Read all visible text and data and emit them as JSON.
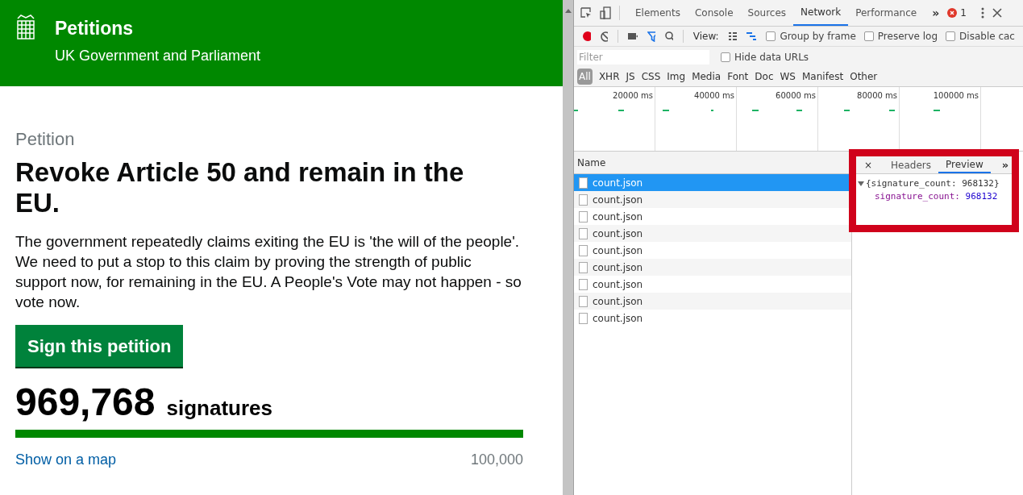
{
  "header": {
    "title": "Petitions",
    "subtitle": "UK Government and Parliament"
  },
  "petition": {
    "label": "Petition",
    "heading": "Revoke Article 50 and remain in the EU.",
    "summary": "The government repeatedly claims exiting the EU is 'the will of the people'. We need to put a stop to this claim by proving the strength of public support now, for remaining in the EU. A People's Vote may not happen - so vote now.",
    "sign_button": "Sign this petition",
    "count": "969,768",
    "count_label": "signatures",
    "progress": {
      "level": 1
    },
    "map_link": "Show on a map",
    "threshold": "100,000"
  },
  "devtools": {
    "tabs": [
      {
        "label": "Elements",
        "selected": false
      },
      {
        "label": "Console",
        "selected": false
      },
      {
        "label": "Sources",
        "selected": false
      },
      {
        "label": "Network",
        "selected": true
      },
      {
        "label": "Performance",
        "selected": false
      }
    ],
    "more_tabs": "»",
    "error_count": "1",
    "view_label": "View:",
    "options": [
      {
        "label": "Group by frame",
        "checked": false
      },
      {
        "label": "Preserve log",
        "checked": false
      },
      {
        "label": "Disable cac",
        "checked": false
      }
    ],
    "filter": {
      "placeholder": "Filter"
    },
    "hide_data_urls": {
      "label": "Hide data URLs",
      "checked": false
    },
    "types": [
      {
        "label": "All",
        "selected": true
      },
      {
        "label": "XHR",
        "selected": false
      },
      {
        "label": "JS",
        "selected": false
      },
      {
        "label": "CSS",
        "selected": false
      },
      {
        "label": "Img",
        "selected": false
      },
      {
        "label": "Media",
        "selected": false
      },
      {
        "label": "Font",
        "selected": false
      },
      {
        "label": "Doc",
        "selected": false
      },
      {
        "label": "WS",
        "selected": false
      },
      {
        "label": "Manifest",
        "selected": false
      },
      {
        "label": "Other",
        "selected": false
      }
    ],
    "timeline_ticks": [
      "20000 ms",
      "40000 ms",
      "60000 ms",
      "80000 ms",
      "100000 ms"
    ],
    "name_column": "Name",
    "requests": [
      {
        "name": "count.json",
        "selected": true
      },
      {
        "name": "count.json",
        "selected": false
      },
      {
        "name": "count.json",
        "selected": false
      },
      {
        "name": "count.json",
        "selected": false
      },
      {
        "name": "count.json",
        "selected": false
      },
      {
        "name": "count.json",
        "selected": false
      },
      {
        "name": "count.json",
        "selected": false
      },
      {
        "name": "count.json",
        "selected": false
      },
      {
        "name": "count.json",
        "selected": false
      }
    ],
    "detail": {
      "close": "×",
      "tabs": [
        {
          "label": "Headers",
          "selected": false
        },
        {
          "label": "Preview",
          "selected": true
        }
      ],
      "more": "»",
      "preview_summary": "{signature_count: 968132}",
      "preview_key": "signature_count:",
      "preview_value": "968132"
    }
  }
}
